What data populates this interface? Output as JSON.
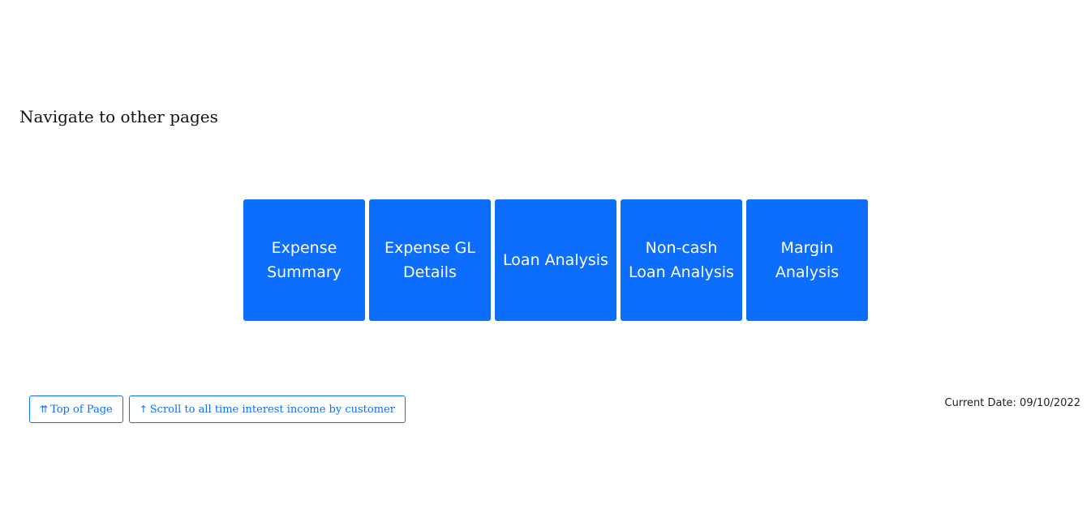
{
  "section": {
    "heading": "Navigate to other pages"
  },
  "nav_tiles": [
    {
      "line1": "Expense",
      "line2": "Summary"
    },
    {
      "line1": "Expense GL",
      "line2": "Details"
    },
    {
      "line1": "Loan Analysis",
      "line2": ""
    },
    {
      "line1": "Non-cash",
      "line2": "Loan Analysis"
    },
    {
      "line1": "Margin",
      "line2": "Analysis"
    }
  ],
  "footer": {
    "top_button": {
      "icon": "⇈",
      "label": "Top of Page"
    },
    "scroll_button": {
      "icon": "↑",
      "label": "Scroll to all time interest income by customer"
    },
    "current_date": "Current Date: 09/10/2022"
  },
  "colors": {
    "accent": "#0d6efd",
    "text": "#111111",
    "background": "#ffffff"
  },
  "icons": {
    "top_button_icon": "double-up-arrow-icon",
    "scroll_button_icon": "up-arrow-icon"
  }
}
